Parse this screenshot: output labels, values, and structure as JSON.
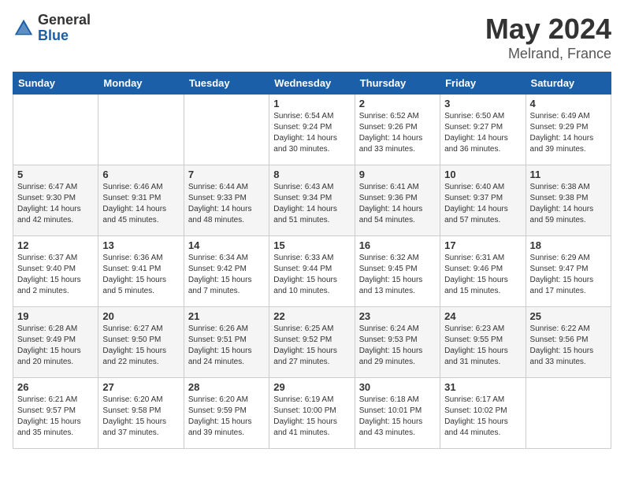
{
  "header": {
    "logo_general": "General",
    "logo_blue": "Blue",
    "month": "May 2024",
    "location": "Melrand, France"
  },
  "weekdays": [
    "Sunday",
    "Monday",
    "Tuesday",
    "Wednesday",
    "Thursday",
    "Friday",
    "Saturday"
  ],
  "weeks": [
    [
      {
        "day": "",
        "info": ""
      },
      {
        "day": "",
        "info": ""
      },
      {
        "day": "",
        "info": ""
      },
      {
        "day": "1",
        "info": "Sunrise: 6:54 AM\nSunset: 9:24 PM\nDaylight: 14 hours and 30 minutes."
      },
      {
        "day": "2",
        "info": "Sunrise: 6:52 AM\nSunset: 9:26 PM\nDaylight: 14 hours and 33 minutes."
      },
      {
        "day": "3",
        "info": "Sunrise: 6:50 AM\nSunset: 9:27 PM\nDaylight: 14 hours and 36 minutes."
      },
      {
        "day": "4",
        "info": "Sunrise: 6:49 AM\nSunset: 9:29 PM\nDaylight: 14 hours and 39 minutes."
      }
    ],
    [
      {
        "day": "5",
        "info": "Sunrise: 6:47 AM\nSunset: 9:30 PM\nDaylight: 14 hours and 42 minutes."
      },
      {
        "day": "6",
        "info": "Sunrise: 6:46 AM\nSunset: 9:31 PM\nDaylight: 14 hours and 45 minutes."
      },
      {
        "day": "7",
        "info": "Sunrise: 6:44 AM\nSunset: 9:33 PM\nDaylight: 14 hours and 48 minutes."
      },
      {
        "day": "8",
        "info": "Sunrise: 6:43 AM\nSunset: 9:34 PM\nDaylight: 14 hours and 51 minutes."
      },
      {
        "day": "9",
        "info": "Sunrise: 6:41 AM\nSunset: 9:36 PM\nDaylight: 14 hours and 54 minutes."
      },
      {
        "day": "10",
        "info": "Sunrise: 6:40 AM\nSunset: 9:37 PM\nDaylight: 14 hours and 57 minutes."
      },
      {
        "day": "11",
        "info": "Sunrise: 6:38 AM\nSunset: 9:38 PM\nDaylight: 14 hours and 59 minutes."
      }
    ],
    [
      {
        "day": "12",
        "info": "Sunrise: 6:37 AM\nSunset: 9:40 PM\nDaylight: 15 hours and 2 minutes."
      },
      {
        "day": "13",
        "info": "Sunrise: 6:36 AM\nSunset: 9:41 PM\nDaylight: 15 hours and 5 minutes."
      },
      {
        "day": "14",
        "info": "Sunrise: 6:34 AM\nSunset: 9:42 PM\nDaylight: 15 hours and 7 minutes."
      },
      {
        "day": "15",
        "info": "Sunrise: 6:33 AM\nSunset: 9:44 PM\nDaylight: 15 hours and 10 minutes."
      },
      {
        "day": "16",
        "info": "Sunrise: 6:32 AM\nSunset: 9:45 PM\nDaylight: 15 hours and 13 minutes."
      },
      {
        "day": "17",
        "info": "Sunrise: 6:31 AM\nSunset: 9:46 PM\nDaylight: 15 hours and 15 minutes."
      },
      {
        "day": "18",
        "info": "Sunrise: 6:29 AM\nSunset: 9:47 PM\nDaylight: 15 hours and 17 minutes."
      }
    ],
    [
      {
        "day": "19",
        "info": "Sunrise: 6:28 AM\nSunset: 9:49 PM\nDaylight: 15 hours and 20 minutes."
      },
      {
        "day": "20",
        "info": "Sunrise: 6:27 AM\nSunset: 9:50 PM\nDaylight: 15 hours and 22 minutes."
      },
      {
        "day": "21",
        "info": "Sunrise: 6:26 AM\nSunset: 9:51 PM\nDaylight: 15 hours and 24 minutes."
      },
      {
        "day": "22",
        "info": "Sunrise: 6:25 AM\nSunset: 9:52 PM\nDaylight: 15 hours and 27 minutes."
      },
      {
        "day": "23",
        "info": "Sunrise: 6:24 AM\nSunset: 9:53 PM\nDaylight: 15 hours and 29 minutes."
      },
      {
        "day": "24",
        "info": "Sunrise: 6:23 AM\nSunset: 9:55 PM\nDaylight: 15 hours and 31 minutes."
      },
      {
        "day": "25",
        "info": "Sunrise: 6:22 AM\nSunset: 9:56 PM\nDaylight: 15 hours and 33 minutes."
      }
    ],
    [
      {
        "day": "26",
        "info": "Sunrise: 6:21 AM\nSunset: 9:57 PM\nDaylight: 15 hours and 35 minutes."
      },
      {
        "day": "27",
        "info": "Sunrise: 6:20 AM\nSunset: 9:58 PM\nDaylight: 15 hours and 37 minutes."
      },
      {
        "day": "28",
        "info": "Sunrise: 6:20 AM\nSunset: 9:59 PM\nDaylight: 15 hours and 39 minutes."
      },
      {
        "day": "29",
        "info": "Sunrise: 6:19 AM\nSunset: 10:00 PM\nDaylight: 15 hours and 41 minutes."
      },
      {
        "day": "30",
        "info": "Sunrise: 6:18 AM\nSunset: 10:01 PM\nDaylight: 15 hours and 43 minutes."
      },
      {
        "day": "31",
        "info": "Sunrise: 6:17 AM\nSunset: 10:02 PM\nDaylight: 15 hours and 44 minutes."
      },
      {
        "day": "",
        "info": ""
      }
    ]
  ]
}
